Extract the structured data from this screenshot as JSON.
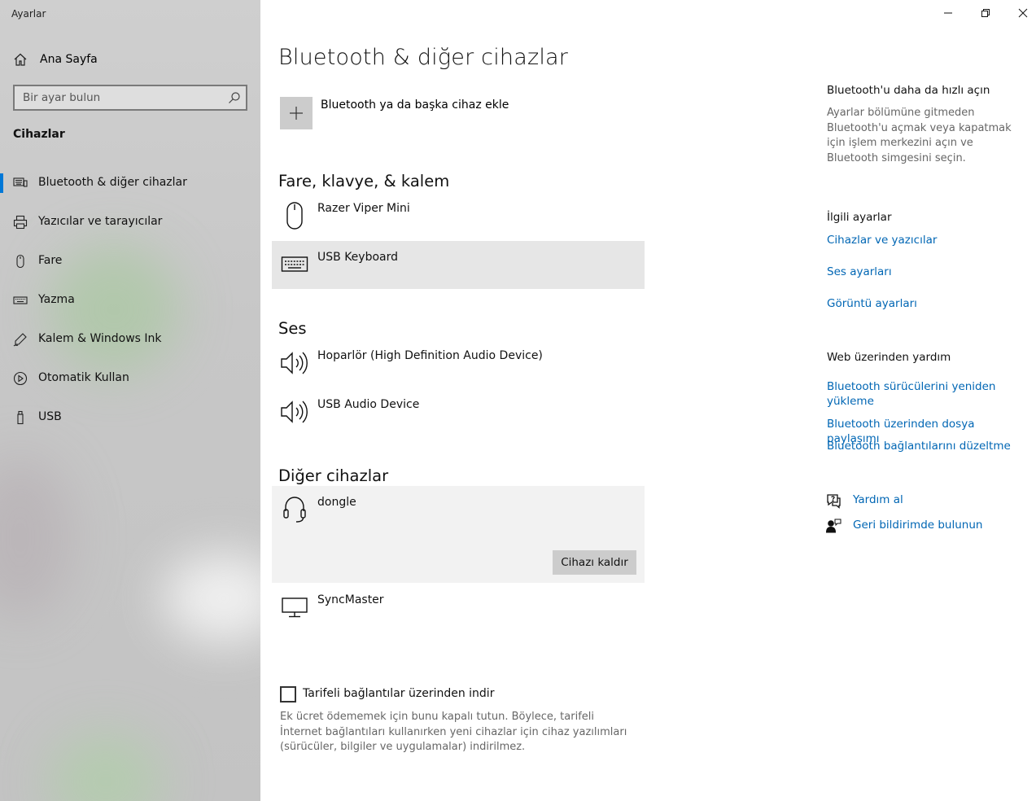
{
  "window": {
    "title": "Ayarlar",
    "controls": {
      "minimize_icon": "minimize-icon",
      "restore_icon": "restore-icon",
      "close_icon": "close-icon"
    }
  },
  "sidebar": {
    "home_label": "Ana Sayfa",
    "search_placeholder": "Bir ayar bulun",
    "section": "Cihazlar",
    "items": [
      {
        "label": "Bluetooth & diğer cihazlar",
        "icon": "bluetooth-devices-icon",
        "active": true
      },
      {
        "label": "Yazıcılar ve tarayıcılar",
        "icon": "printer-icon"
      },
      {
        "label": "Fare",
        "icon": "mouse-icon"
      },
      {
        "label": "Yazma",
        "icon": "keyboard-icon"
      },
      {
        "label": "Kalem & Windows Ink",
        "icon": "pen-icon"
      },
      {
        "label": "Otomatik Kullan",
        "icon": "autoplay-icon"
      },
      {
        "label": "USB",
        "icon": "usb-icon"
      }
    ]
  },
  "main": {
    "title": "Bluetooth & diğer cihazlar",
    "add_device_label": "Bluetooth ya da başka cihaz ekle",
    "groups": {
      "input": {
        "title": "Fare, klavye, & kalem",
        "devices": [
          {
            "name": "Razer Viper Mini",
            "icon": "mouse-icon"
          },
          {
            "name": "USB Keyboard",
            "icon": "keyboard-icon"
          }
        ]
      },
      "audio": {
        "title": "Ses",
        "devices": [
          {
            "name": "Hoparlör (High Definition Audio Device)",
            "icon": "speaker-icon"
          },
          {
            "name": "USB Audio Device",
            "icon": "speaker-icon"
          }
        ]
      },
      "other": {
        "title": "Diğer cihazlar",
        "devices": [
          {
            "name": "dongle",
            "icon": "headset-icon",
            "action": "Cihazı kaldır"
          },
          {
            "name": "SyncMaster",
            "icon": "monitor-icon"
          }
        ]
      }
    },
    "metered_checkbox_label": "Tarifeli bağlantılar üzerinden indir",
    "metered_checked": false,
    "metered_description": "Ek ücret ödememek için bunu kapalı tutun. Böylece, tarifeli İnternet bağlantıları kullanırken yeni cihazlar için cihaz yazılımları (sürücüler, bilgiler ve uygulamalar) indirilmez."
  },
  "right_panel": {
    "faster_title": "Bluetooth'u daha da hızlı açın",
    "faster_text": "Ayarlar bölümüne gitmeden Bluetooth'u açmak veya kapatmak için işlem merkezini açın ve Bluetooth simgesini seçin.",
    "related_title": "İlgili ayarlar",
    "related_links": [
      "Cihazlar ve yazıcılar",
      "Ses ayarları",
      "Görüntü ayarları"
    ],
    "web_help_title": "Web üzerinden yardım",
    "web_help_links": [
      "Bluetooth sürücülerini yeniden yükleme",
      "Bluetooth üzerinden dosya paylaşımı",
      "Bluetooth bağlantılarını düzeltme"
    ],
    "get_help": "Yardım al",
    "feedback": "Geri bildirimde bulunun"
  },
  "colors": {
    "accent": "#0078d7",
    "link": "#0066b4",
    "sidebar_bg": "#c8c8c8",
    "hover_row": "#e6e6e6",
    "selected_row": "#f2f2f2"
  }
}
